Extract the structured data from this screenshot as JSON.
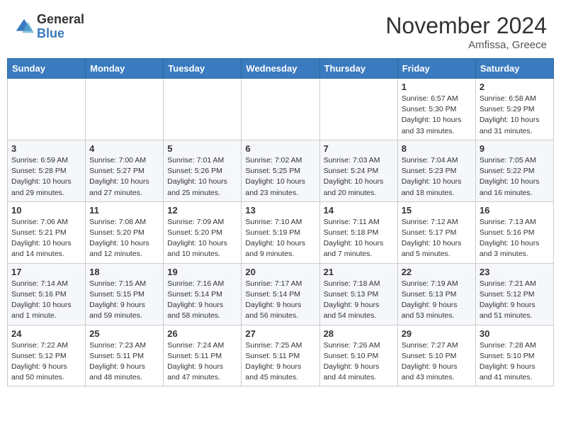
{
  "header": {
    "logo_general": "General",
    "logo_blue": "Blue",
    "month": "November 2024",
    "location": "Amfissa, Greece"
  },
  "weekdays": [
    "Sunday",
    "Monday",
    "Tuesday",
    "Wednesday",
    "Thursday",
    "Friday",
    "Saturday"
  ],
  "weeks": [
    [
      {
        "day": "",
        "info": ""
      },
      {
        "day": "",
        "info": ""
      },
      {
        "day": "",
        "info": ""
      },
      {
        "day": "",
        "info": ""
      },
      {
        "day": "",
        "info": ""
      },
      {
        "day": "1",
        "info": "Sunrise: 6:57 AM\nSunset: 5:30 PM\nDaylight: 10 hours and 33 minutes."
      },
      {
        "day": "2",
        "info": "Sunrise: 6:58 AM\nSunset: 5:29 PM\nDaylight: 10 hours and 31 minutes."
      }
    ],
    [
      {
        "day": "3",
        "info": "Sunrise: 6:59 AM\nSunset: 5:28 PM\nDaylight: 10 hours and 29 minutes."
      },
      {
        "day": "4",
        "info": "Sunrise: 7:00 AM\nSunset: 5:27 PM\nDaylight: 10 hours and 27 minutes."
      },
      {
        "day": "5",
        "info": "Sunrise: 7:01 AM\nSunset: 5:26 PM\nDaylight: 10 hours and 25 minutes."
      },
      {
        "day": "6",
        "info": "Sunrise: 7:02 AM\nSunset: 5:25 PM\nDaylight: 10 hours and 23 minutes."
      },
      {
        "day": "7",
        "info": "Sunrise: 7:03 AM\nSunset: 5:24 PM\nDaylight: 10 hours and 20 minutes."
      },
      {
        "day": "8",
        "info": "Sunrise: 7:04 AM\nSunset: 5:23 PM\nDaylight: 10 hours and 18 minutes."
      },
      {
        "day": "9",
        "info": "Sunrise: 7:05 AM\nSunset: 5:22 PM\nDaylight: 10 hours and 16 minutes."
      }
    ],
    [
      {
        "day": "10",
        "info": "Sunrise: 7:06 AM\nSunset: 5:21 PM\nDaylight: 10 hours and 14 minutes."
      },
      {
        "day": "11",
        "info": "Sunrise: 7:08 AM\nSunset: 5:20 PM\nDaylight: 10 hours and 12 minutes."
      },
      {
        "day": "12",
        "info": "Sunrise: 7:09 AM\nSunset: 5:20 PM\nDaylight: 10 hours and 10 minutes."
      },
      {
        "day": "13",
        "info": "Sunrise: 7:10 AM\nSunset: 5:19 PM\nDaylight: 10 hours and 9 minutes."
      },
      {
        "day": "14",
        "info": "Sunrise: 7:11 AM\nSunset: 5:18 PM\nDaylight: 10 hours and 7 minutes."
      },
      {
        "day": "15",
        "info": "Sunrise: 7:12 AM\nSunset: 5:17 PM\nDaylight: 10 hours and 5 minutes."
      },
      {
        "day": "16",
        "info": "Sunrise: 7:13 AM\nSunset: 5:16 PM\nDaylight: 10 hours and 3 minutes."
      }
    ],
    [
      {
        "day": "17",
        "info": "Sunrise: 7:14 AM\nSunset: 5:16 PM\nDaylight: 10 hours and 1 minute."
      },
      {
        "day": "18",
        "info": "Sunrise: 7:15 AM\nSunset: 5:15 PM\nDaylight: 9 hours and 59 minutes."
      },
      {
        "day": "19",
        "info": "Sunrise: 7:16 AM\nSunset: 5:14 PM\nDaylight: 9 hours and 58 minutes."
      },
      {
        "day": "20",
        "info": "Sunrise: 7:17 AM\nSunset: 5:14 PM\nDaylight: 9 hours and 56 minutes."
      },
      {
        "day": "21",
        "info": "Sunrise: 7:18 AM\nSunset: 5:13 PM\nDaylight: 9 hours and 54 minutes."
      },
      {
        "day": "22",
        "info": "Sunrise: 7:19 AM\nSunset: 5:13 PM\nDaylight: 9 hours and 53 minutes."
      },
      {
        "day": "23",
        "info": "Sunrise: 7:21 AM\nSunset: 5:12 PM\nDaylight: 9 hours and 51 minutes."
      }
    ],
    [
      {
        "day": "24",
        "info": "Sunrise: 7:22 AM\nSunset: 5:12 PM\nDaylight: 9 hours and 50 minutes."
      },
      {
        "day": "25",
        "info": "Sunrise: 7:23 AM\nSunset: 5:11 PM\nDaylight: 9 hours and 48 minutes."
      },
      {
        "day": "26",
        "info": "Sunrise: 7:24 AM\nSunset: 5:11 PM\nDaylight: 9 hours and 47 minutes."
      },
      {
        "day": "27",
        "info": "Sunrise: 7:25 AM\nSunset: 5:11 PM\nDaylight: 9 hours and 45 minutes."
      },
      {
        "day": "28",
        "info": "Sunrise: 7:26 AM\nSunset: 5:10 PM\nDaylight: 9 hours and 44 minutes."
      },
      {
        "day": "29",
        "info": "Sunrise: 7:27 AM\nSunset: 5:10 PM\nDaylight: 9 hours and 43 minutes."
      },
      {
        "day": "30",
        "info": "Sunrise: 7:28 AM\nSunset: 5:10 PM\nDaylight: 9 hours and 41 minutes."
      }
    ]
  ]
}
